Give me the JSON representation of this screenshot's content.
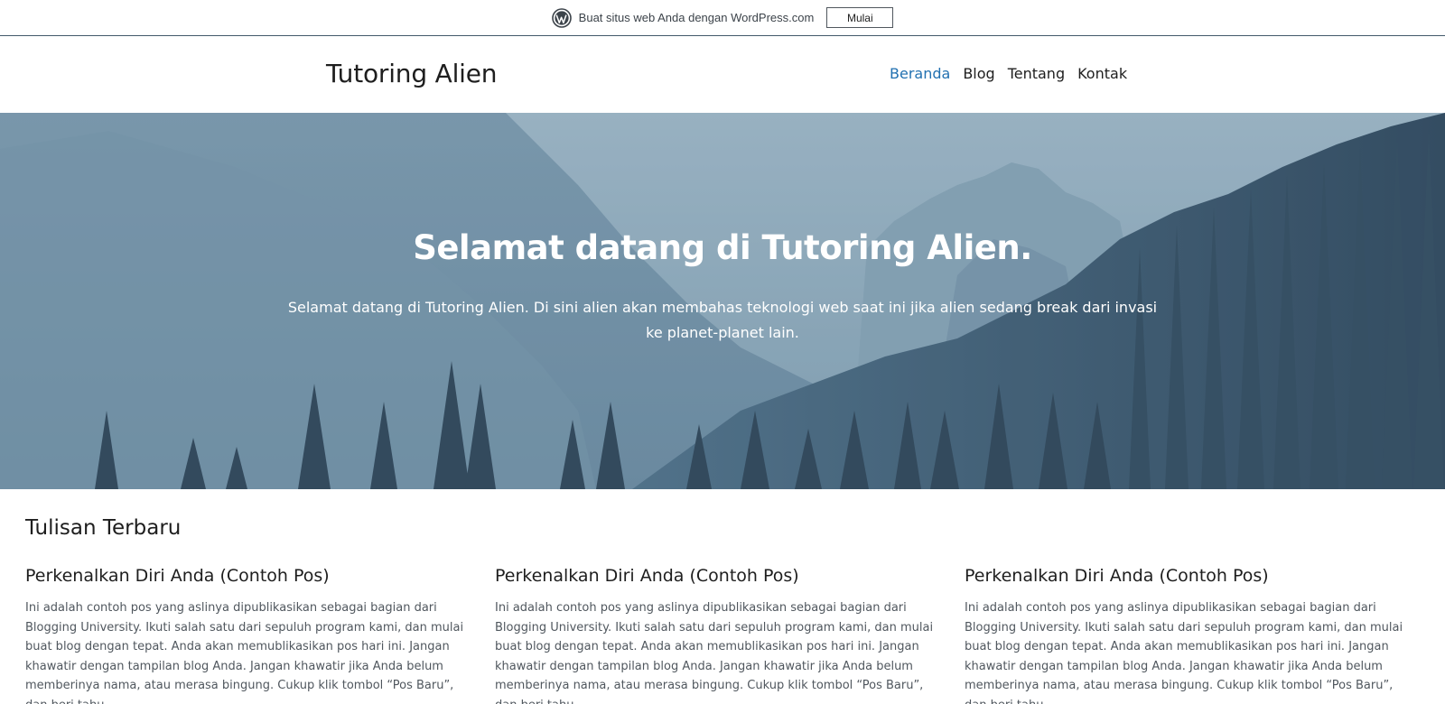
{
  "banner": {
    "text": "Buat situs web Anda dengan WordPress.com",
    "button_label": "Mulai"
  },
  "header": {
    "site_title": "Tutoring Alien",
    "nav": [
      {
        "label": "Beranda",
        "active": true
      },
      {
        "label": "Blog",
        "active": false
      },
      {
        "label": "Tentang",
        "active": false
      },
      {
        "label": "Kontak",
        "active": false
      }
    ]
  },
  "hero": {
    "title": "Selamat datang di Tutoring Alien.",
    "text": "Selamat datang di Tutoring Alien. Di sini alien akan membahas teknologi web saat ini jika alien sedang break dari invasi ke planet-planet lain."
  },
  "recent": {
    "heading": "Tulisan Terbaru",
    "posts": [
      {
        "title": "Perkenalkan Diri Anda (Contoh Pos)",
        "excerpt": "Ini adalah contoh pos yang aslinya dipublikasikan sebagai bagian dari Blogging University. Ikuti salah satu dari sepuluh program kami, dan mulai buat blog dengan tepat. Anda akan memublikasikan pos hari ini. Jangan khawatir dengan tampilan blog Anda. Jangan khawatir jika Anda belum memberinya nama, atau merasa bingung. Cukup klik tombol “Pos Baru”, dan beri tahu"
      },
      {
        "title": "Perkenalkan Diri Anda (Contoh Pos)",
        "excerpt": "Ini adalah contoh pos yang aslinya dipublikasikan sebagai bagian dari Blogging University. Ikuti salah satu dari sepuluh program kami, dan mulai buat blog dengan tepat. Anda akan memublikasikan pos hari ini. Jangan khawatir dengan tampilan blog Anda. Jangan khawatir jika Anda belum memberinya nama, atau merasa bingung. Cukup klik tombol “Pos Baru”, dan beri tahu"
      },
      {
        "title": "Perkenalkan Diri Anda (Contoh Pos)",
        "excerpt": "Ini adalah contoh pos yang aslinya dipublikasikan sebagai bagian dari Blogging University. Ikuti salah satu dari sepuluh program kami, dan mulai buat blog dengan tepat. Anda akan memublikasikan pos hari ini. Jangan khawatir dengan tampilan blog Anda. Jangan khawatir jika Anda belum memberinya nama, atau merasa bingung. Cukup klik tombol “Pos Baru”, dan beri tahu"
      }
    ]
  },
  "colors": {
    "accent": "#2271b1",
    "banner_border": "#43596b",
    "hero_sky": "#8eabbb"
  }
}
